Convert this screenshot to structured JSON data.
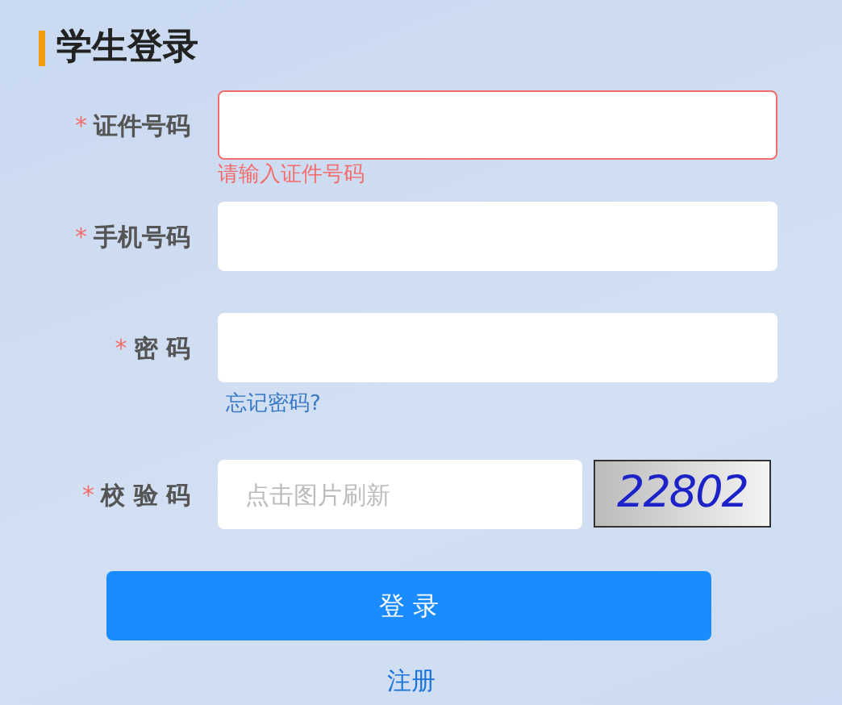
{
  "title": "学生登录",
  "fields": [
    {
      "kind": "text",
      "label": "证件号码",
      "required": true,
      "invalid": true,
      "error": "请输入证件号码"
    },
    {
      "kind": "text",
      "label": "手机号码",
      "required": true,
      "invalid": false
    },
    {
      "kind": "password",
      "label": "密 码",
      "required": true,
      "invalid": false,
      "link": "忘记密码?"
    },
    {
      "kind": "captcha",
      "label": "校 验 码",
      "required": true,
      "invalid": false,
      "placeholder": "点击图片刷新",
      "captcha": "22802"
    }
  ],
  "login_button": "登 录",
  "register_link": "注册",
  "required_mark": "*"
}
